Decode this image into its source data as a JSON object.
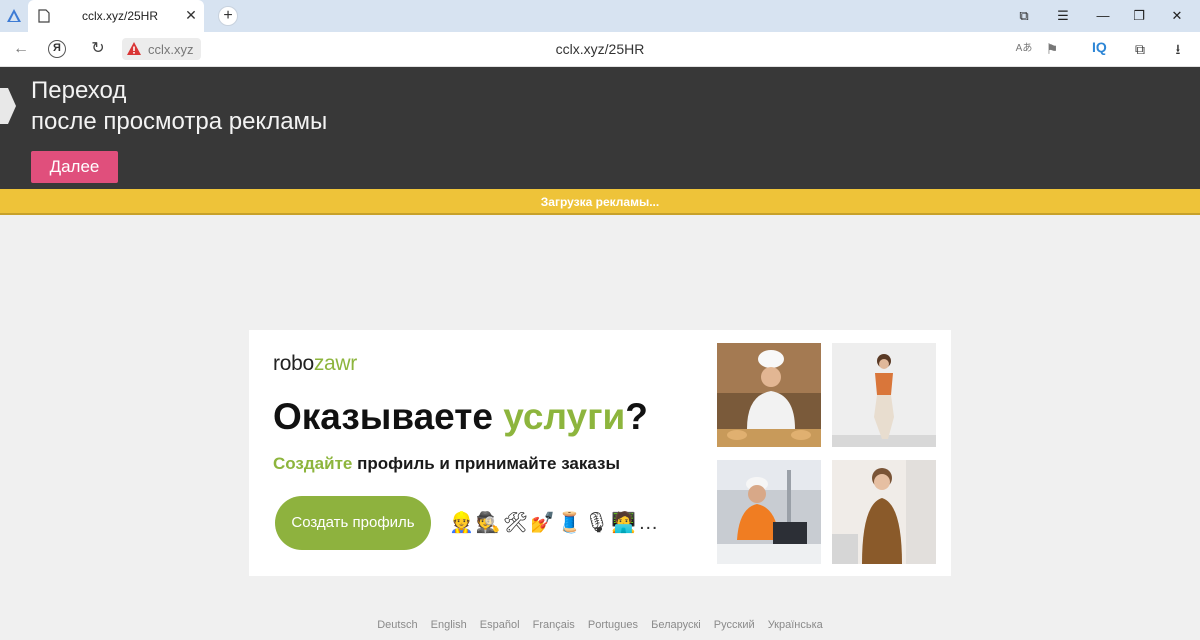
{
  "browser": {
    "tab": {
      "title": "cclx.xyz/25HR",
      "close_glyph": "✕"
    },
    "new_tab_glyph": "+",
    "window_controls": {
      "collections_icon": "⧉",
      "menu": "☰",
      "minimize": "—",
      "restore": "❐",
      "close": "✕"
    },
    "address": {
      "back": "←",
      "yandex": "Я",
      "reload": "↻",
      "host": "cclx.xyz",
      "url": "cclx.xyz/25HR",
      "warning_icon": "warning-icon"
    },
    "toolbar": {
      "translate": "Aあ",
      "bookmark": "⚑",
      "iq": "IQ",
      "extensions": "⧉",
      "download": "⭳"
    }
  },
  "header": {
    "line1": "Переход",
    "line2": "после просмотра рекламы",
    "next_button": "Далее",
    "accent_color": "#e04f7c"
  },
  "loading_bar": {
    "text": "Загрузка рекламы...",
    "color": "#eec339"
  },
  "ad": {
    "logo_a": "robo",
    "logo_b": "zawr",
    "headline_a": "Оказываете ",
    "headline_b": "услуги",
    "headline_c": "?",
    "sub_a": "Создайте",
    "sub_b": " профиль и принимайте заказы",
    "cta": "Создать профиль",
    "emojis": "👷🕵🛠💅🧵🎙🧑‍💻…",
    "brand_color": "#8db53d",
    "photos": [
      "chef-photo",
      "yoga-woman-photo",
      "engineer-photo",
      "tailor-photo"
    ]
  },
  "languages": [
    "Deutsch",
    "English",
    "Español",
    "Français",
    "Portugues",
    "Беларускі",
    "Русский",
    "Українська"
  ]
}
